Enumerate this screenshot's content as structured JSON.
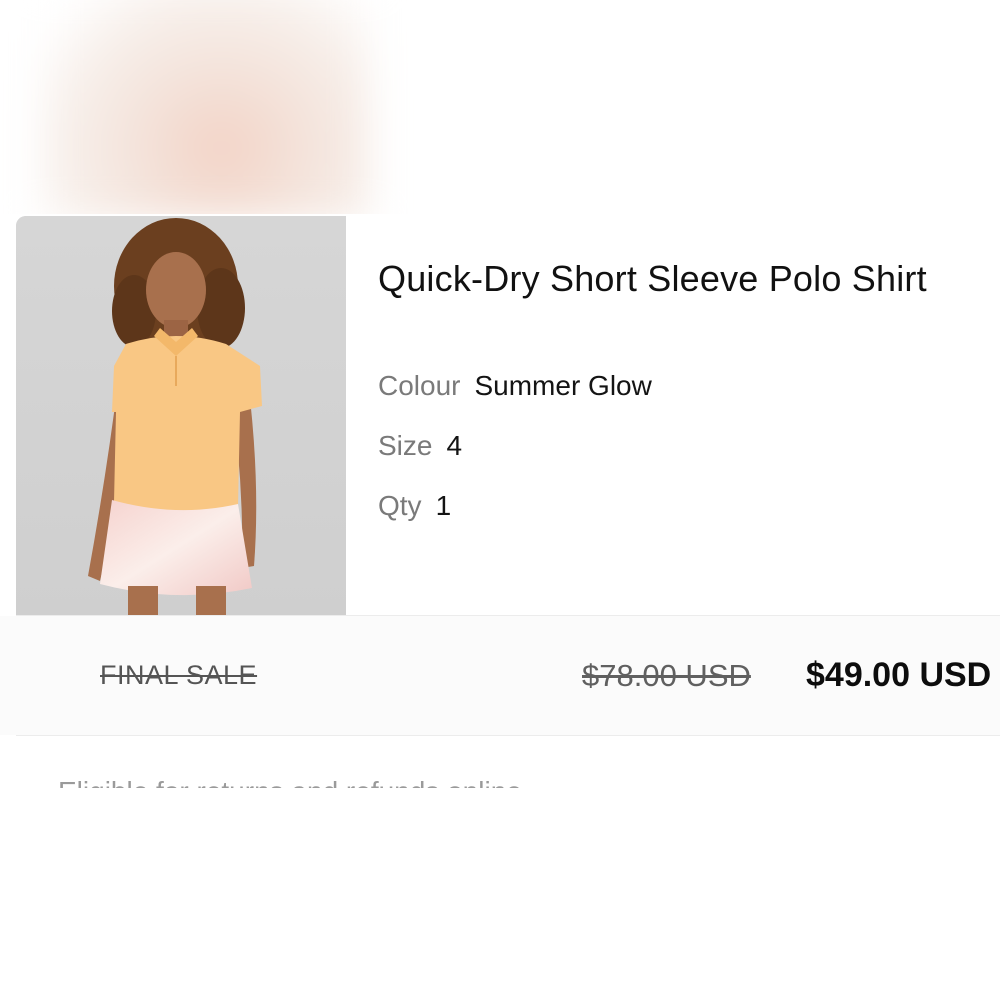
{
  "product": {
    "title": "Quick-Dry Short Sleeve Polo Shirt",
    "image_alt": "product-photo",
    "attributes": [
      {
        "label": "Colour",
        "value": "Summer Glow"
      },
      {
        "label": "Size",
        "value": "4"
      },
      {
        "label": "Qty",
        "value": "1"
      }
    ]
  },
  "pricing": {
    "final_sale_label": "FINAL SALE",
    "original_price": "$78.00 USD",
    "sale_price": "$49.00 USD"
  },
  "footer_cut_text": "Eligible for returns and refunds online",
  "colors": {
    "background": "#ffffff",
    "price_band": "#fbfbfb",
    "muted_text": "#7a7a7a",
    "shirt": "#f9c784"
  }
}
